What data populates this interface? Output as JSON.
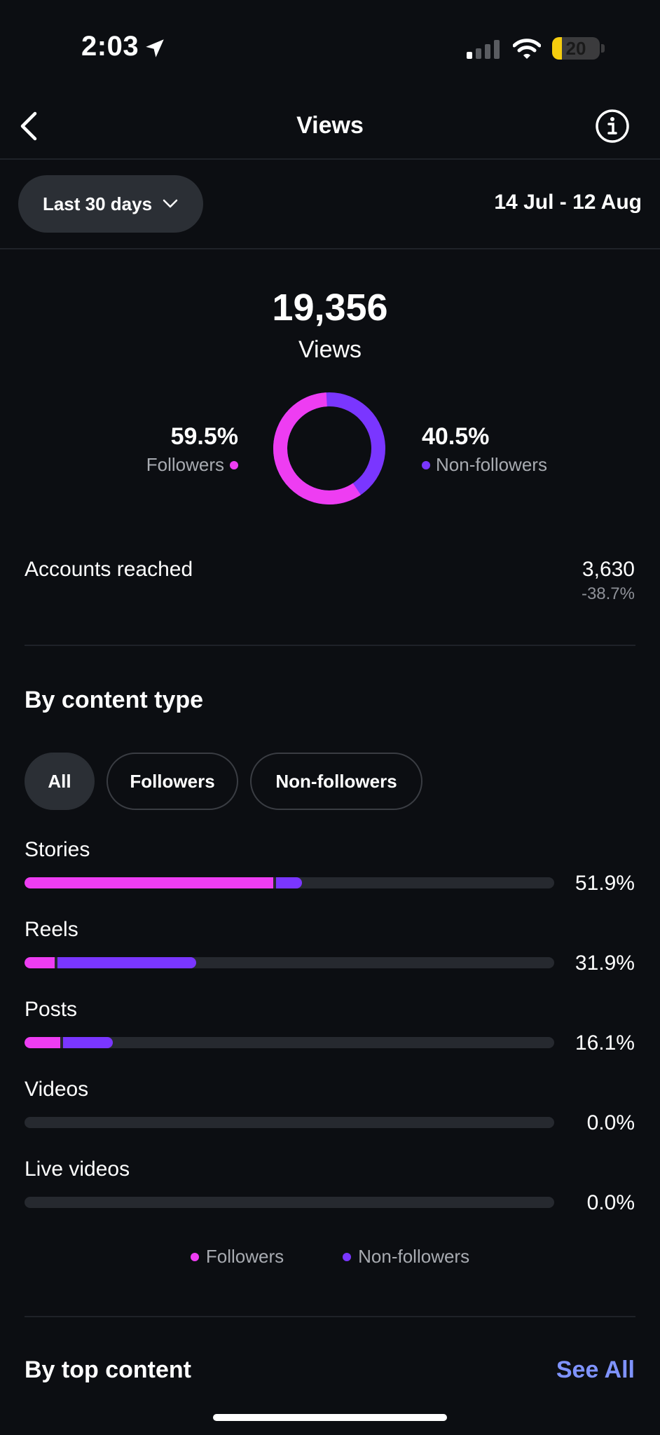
{
  "status_bar": {
    "time": "2:03",
    "battery": "20",
    "battery_level": 0.2
  },
  "header": {
    "title": "Views"
  },
  "range": {
    "selected": "Last 30 days",
    "dates": "14 Jul - 12 Aug"
  },
  "summary": {
    "total": "19,356",
    "label": "Views",
    "followers_pct": "59.5%",
    "followers_label": "Followers",
    "nonfollowers_pct": "40.5%",
    "nonfollowers_label": "Non-followers",
    "followers_share": 0.595
  },
  "reach": {
    "label": "Accounts reached",
    "value": "3,630",
    "change": "-38.7%"
  },
  "content_type": {
    "title": "By content type",
    "filters": [
      "All",
      "Followers",
      "Non-followers"
    ],
    "active_filter": "All",
    "rows": [
      {
        "label": "Stories",
        "pct": "51.9%",
        "followers_share": 0.47,
        "nonfollowers_share": 0.049
      },
      {
        "label": "Reels",
        "pct": "31.9%",
        "followers_share": 0.057,
        "nonfollowers_share": 0.262
      },
      {
        "label": "Posts",
        "pct": "16.1%",
        "followers_share": 0.068,
        "nonfollowers_share": 0.093
      },
      {
        "label": "Videos",
        "pct": "0.0%",
        "followers_share": 0,
        "nonfollowers_share": 0
      },
      {
        "label": "Live videos",
        "pct": "0.0%",
        "followers_share": 0,
        "nonfollowers_share": 0
      }
    ],
    "legend": [
      "Followers",
      "Non-followers"
    ]
  },
  "top_content": {
    "title": "By top content",
    "see_all": "See All"
  },
  "colors": {
    "followers": "#ee3df2",
    "nonfollowers": "#7a36ff",
    "link": "#7f93ff",
    "background": "#0c0e12"
  }
}
